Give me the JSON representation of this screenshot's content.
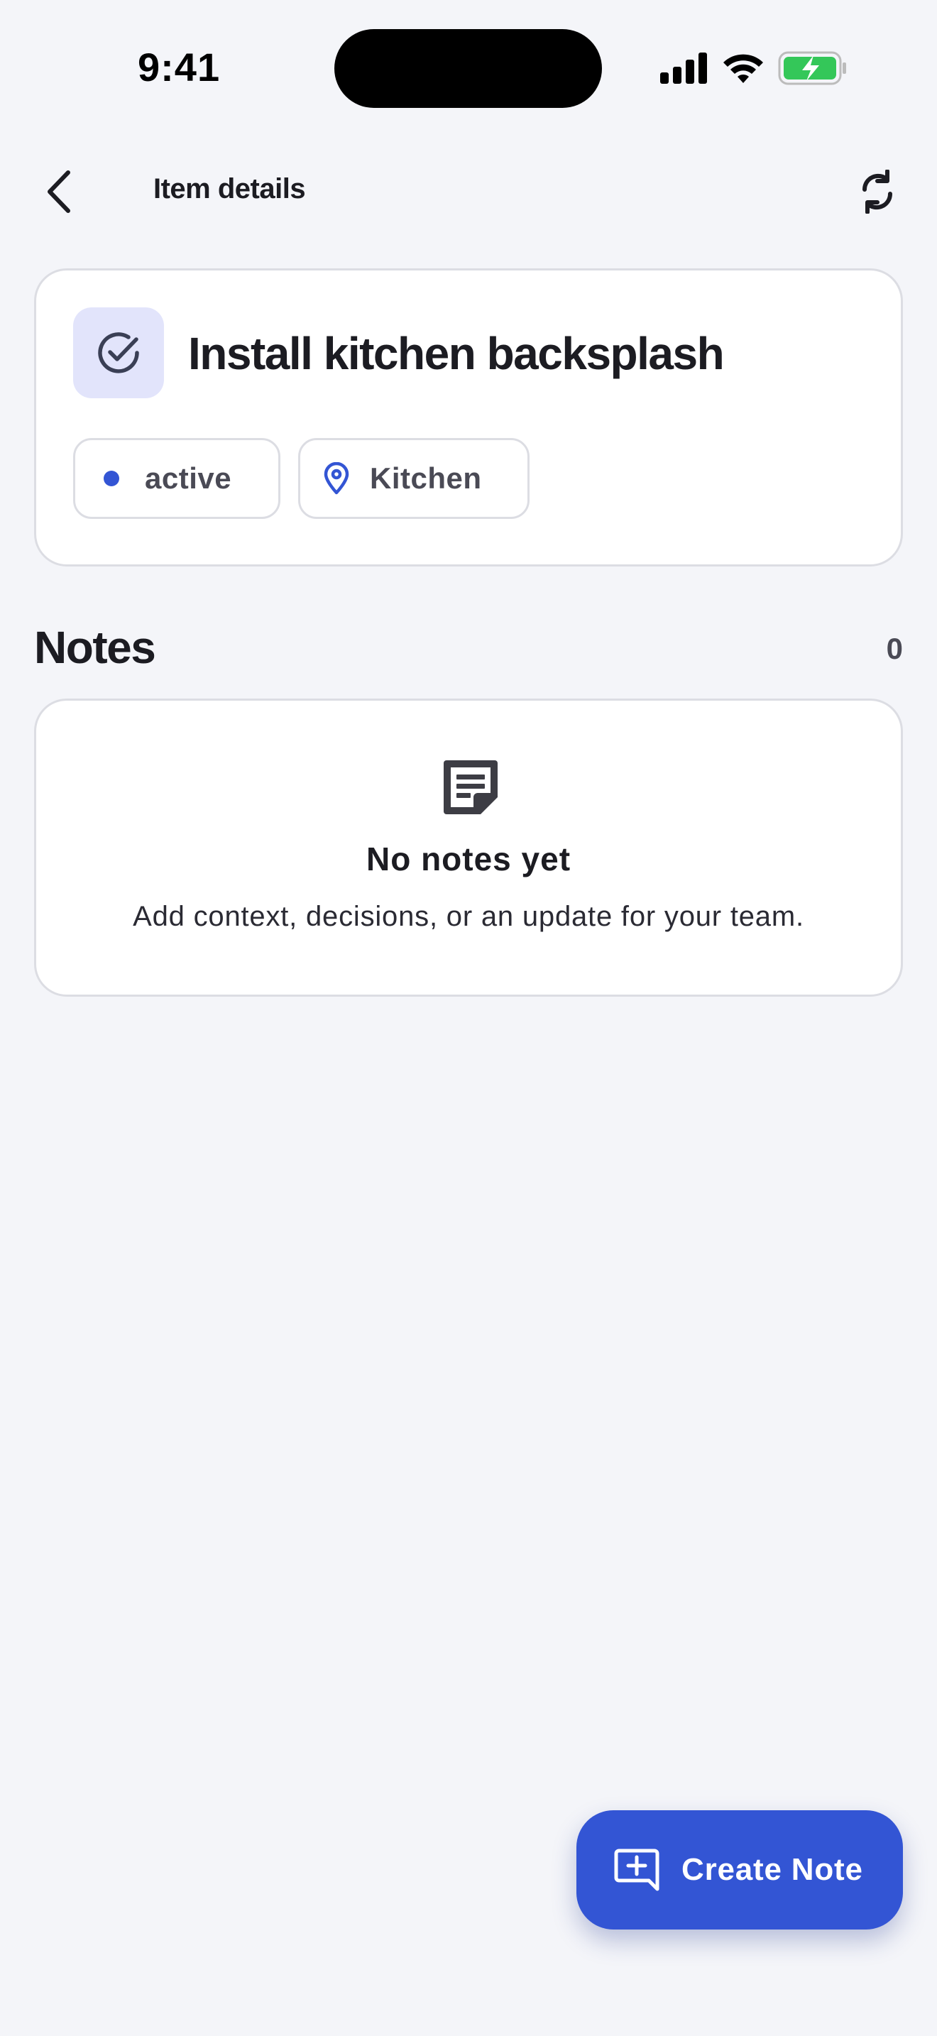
{
  "status_bar": {
    "time": "9:41",
    "icons": [
      "signal-icon",
      "wifi-icon",
      "battery-charging-icon"
    ],
    "battery_color": "#34c759"
  },
  "header": {
    "title": "Item details",
    "back_icon": "chevron-left-icon",
    "refresh_icon": "refresh-icon"
  },
  "item": {
    "title": "Install kitchen backsplash",
    "icon": "check-circle-icon",
    "status": "active",
    "location": "Kitchen",
    "location_icon": "map-pin-icon"
  },
  "notes": {
    "heading": "Notes",
    "count": "0",
    "empty_icon": "note-icon",
    "empty_title": "No notes yet",
    "empty_description": "Add context, decisions, or an update for your team."
  },
  "fab": {
    "label": "Create Note",
    "icon": "add-comment-icon"
  },
  "colors": {
    "accent": "#3355d4",
    "background": "#f4f5f9",
    "icon_tile": "#e2e4fb"
  }
}
